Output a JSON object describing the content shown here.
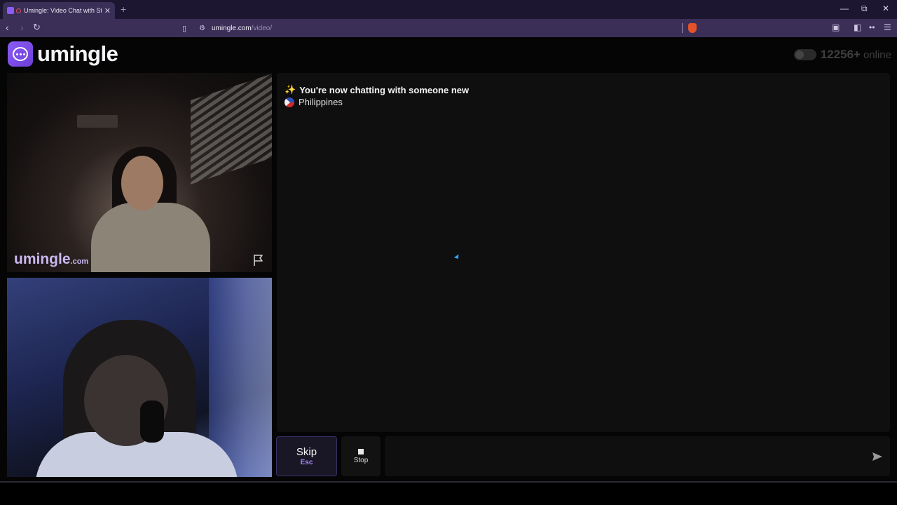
{
  "browser": {
    "tab_title": "Umingle: Video Chat with Stra",
    "tab_close": "✕",
    "new_tab": "+",
    "url_host": "umingle.com",
    "url_path": "/video/",
    "window": {
      "minimize": "—",
      "restore": "⧉",
      "close": "✕"
    }
  },
  "header": {
    "logo_text": "umingle",
    "online_count": "12256+",
    "online_label": "online"
  },
  "video": {
    "watermark_main": "umingle",
    "watermark_suffix": ".com"
  },
  "chat": {
    "message_connected": "You're now chatting with someone new",
    "message_country": "Philippines",
    "input_placeholder": ""
  },
  "controls": {
    "skip_label": "Skip",
    "skip_key": "Esc",
    "stop_label": "Stop"
  },
  "colors": {
    "brand": "#8b5cf6",
    "browser_chrome": "#3b2f58",
    "chat_bg": "#0f0f0f"
  }
}
